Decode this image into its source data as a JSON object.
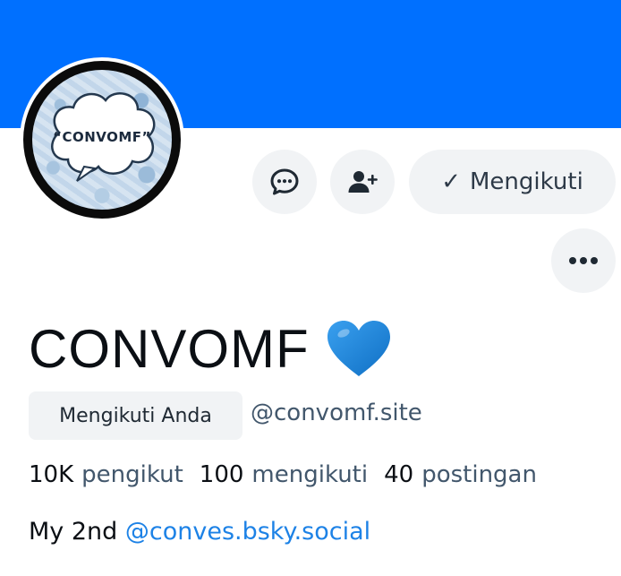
{
  "colors": {
    "banner": "#0070ff",
    "button_bg": "#f1f3f5",
    "text_primary": "#0b0f14",
    "text_secondary": "#42576c",
    "link": "#1d82e6",
    "heart": "#1a86d8"
  },
  "avatar": {
    "text": "“CONVOMF”"
  },
  "actions": {
    "message_icon": "chat-bubble-icon",
    "add_icon": "user-plus-icon",
    "more_icon": "ellipsis-icon",
    "following_label": "Mengikuti"
  },
  "profile": {
    "display_name": "CONVOMF",
    "follows_you_label": "Mengikuti Anda",
    "handle": "@convomf.site",
    "stats": {
      "followers_count": "10K",
      "followers_label": "pengikut",
      "following_count": "100",
      "following_label": "mengikuti",
      "posts_count": "40",
      "posts_label": "postingan"
    },
    "bio_prefix": "My 2nd ",
    "bio_mention": "@conves.bsky.social"
  }
}
